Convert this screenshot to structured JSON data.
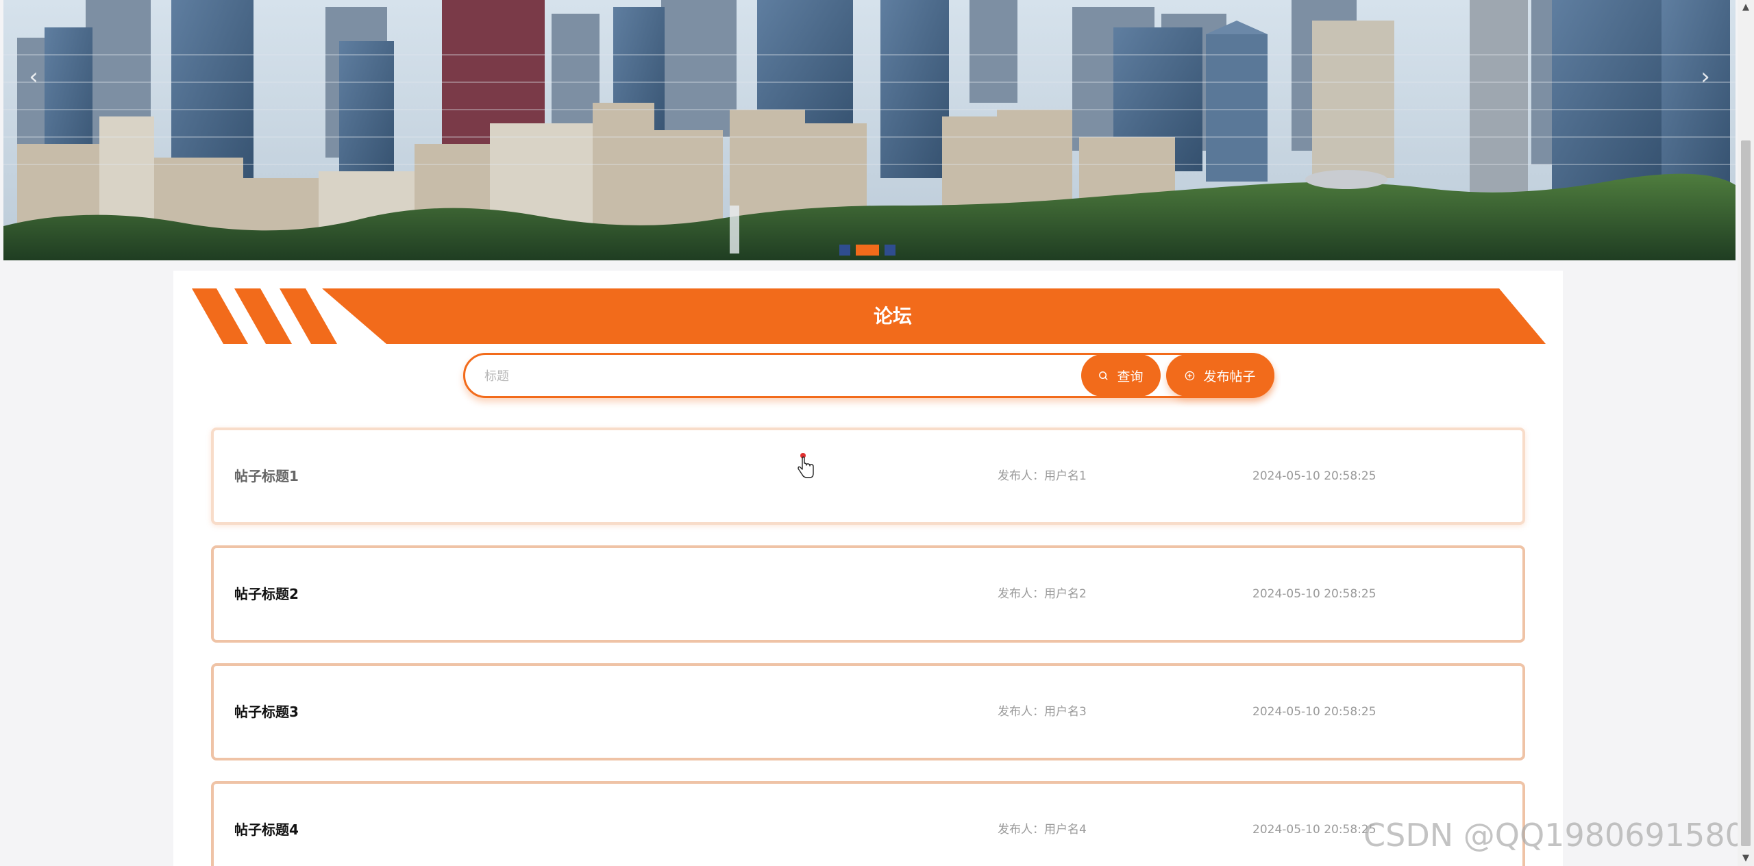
{
  "banner": {
    "prev_label": "‹",
    "next_label": "›",
    "slide_count": 3,
    "active_slide": 2
  },
  "forum": {
    "title": "论坛"
  },
  "search": {
    "placeholder": "标题",
    "value": "",
    "query_label": "查询",
    "publish_label": "发布帖子"
  },
  "posts": [
    {
      "title": "帖子标题1",
      "author": "发布人：用户名1",
      "time": "2024-05-10 20:58:25"
    },
    {
      "title": "帖子标题2",
      "author": "发布人：用户名2",
      "time": "2024-05-10 20:58:25"
    },
    {
      "title": "帖子标题3",
      "author": "发布人：用户名3",
      "time": "2024-05-10 20:58:25"
    },
    {
      "title": "帖子标题4",
      "author": "发布人：用户名4",
      "time": "2024-05-10 20:58:25"
    }
  ],
  "watermark": "CSDN @QQ1980691580",
  "colors": {
    "accent": "#f26b1b",
    "dot_inactive": "#2f4d8f",
    "card_border": "#efc3a6"
  },
  "icons": {
    "query": "search-icon",
    "publish": "plus-circle-icon"
  }
}
